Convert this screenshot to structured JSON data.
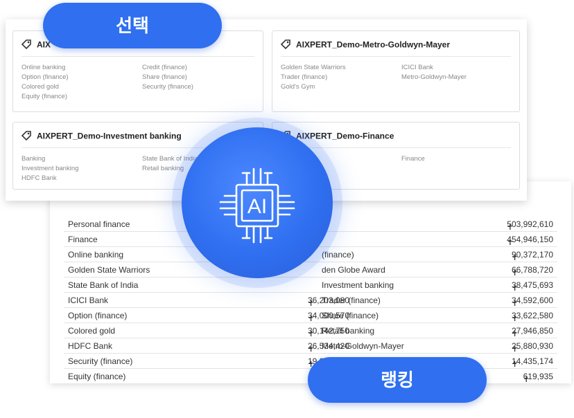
{
  "ranking_table": {
    "rows": [
      {
        "left_name": "Personal finance",
        "left_value": "",
        "right_name": "",
        "right_value": "503,992,610"
      },
      {
        "left_name": "Finance",
        "left_value": "",
        "right_name": "",
        "right_value": "454,946,150"
      },
      {
        "left_name": "Online banking",
        "left_value": "",
        "right_name": "(finance)",
        "right_value": "90,372,170"
      },
      {
        "left_name": "Golden State Warriors",
        "left_value": "",
        "right_name": "den Globe Award",
        "right_value": "66,788,720"
      },
      {
        "left_name": "State Bank of India",
        "left_value": "",
        "right_name": "Investment banking",
        "right_value": "38,475,693"
      },
      {
        "left_name": "ICICI Bank",
        "left_value": "36,203,080",
        "right_name": "Trader (finance)",
        "right_value": "34,592,600"
      },
      {
        "left_name": "Option (finance)",
        "left_value": "34,000,570",
        "right_name": "Share (finance)",
        "right_value": "33,622,580"
      },
      {
        "left_name": "Colored gold",
        "left_value": "30,142,750",
        "right_name": "Retail banking",
        "right_value": "27,946,850"
      },
      {
        "left_name": "HDFC Bank",
        "left_value": "26,534,420",
        "right_name": "Metro-Goldwyn-Mayer",
        "right_value": "25,880,930"
      },
      {
        "left_name": "Security (finance)",
        "left_value": "19,983,890",
        "right_name": "",
        "right_value": "14,435,174"
      },
      {
        "left_name": "Equity (finance)",
        "left_value": "10,790,550",
        "right_name": "",
        "right_value": "619,935"
      }
    ]
  },
  "cards": [
    {
      "title": "AIX",
      "items": [
        "Online banking",
        "Option (finance)",
        "Colored gold",
        "Equity (finance)",
        "Credit (finance)",
        "Share (finance)",
        "Security (finance)"
      ]
    },
    {
      "title": "AIXPERT_Demo-Metro-Goldwyn-Mayer",
      "items": [
        "Golden State Warriors",
        "Trader (finance)",
        "Gold's Gym",
        "ICICI Bank",
        "Metro-Goldwyn-Mayer"
      ]
    },
    {
      "title": "AIXPERT_Demo-Investment banking",
      "items": [
        "Banking",
        "Investment banking",
        "HDFC Bank",
        "State Bank of India",
        "Retail banking"
      ]
    },
    {
      "title": "AIXPERT_Demo-Finance",
      "items": [
        "Finance"
      ]
    }
  ],
  "pills": {
    "select_label": "선택",
    "ranking_label": "랭킹"
  },
  "badge": {
    "label": "AI",
    "icon": "ai-chip-icon"
  },
  "colors": {
    "accent": "#2f6ff0",
    "muted_text": "#888888",
    "border": "#dcdcdc"
  }
}
